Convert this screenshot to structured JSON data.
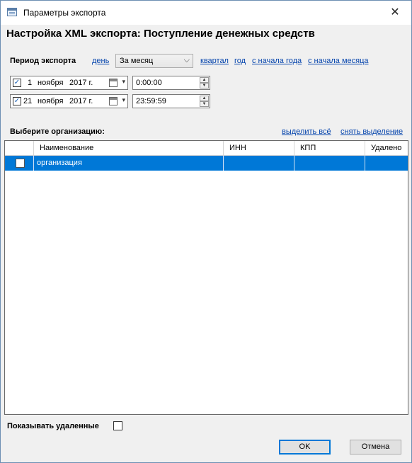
{
  "window": {
    "title": "Параметры экспорта",
    "close_glyph": "✕"
  },
  "header": {
    "title": "Настройка XML экспорта: Поступление денежных средств"
  },
  "period": {
    "label": "Период экспорта",
    "link_day": "день",
    "select_value": "За месяц",
    "link_quarter": "квартал",
    "link_year": "год",
    "link_year_start": "с начала года",
    "link_month_start": "с начала месяца"
  },
  "date_from": {
    "day": "1",
    "month": "ноября",
    "year": "2017 г.",
    "time": "0:00:00",
    "checked": true
  },
  "date_to": {
    "day": "21",
    "month": "ноября",
    "year": "2017 г.",
    "time": "23:59:59",
    "checked": true
  },
  "org": {
    "label": "Выберите организацию:",
    "select_all": "выделить всё",
    "deselect": "снять выделение",
    "columns": [
      "Наименование",
      "ИНН",
      "КПП",
      "Удалено"
    ],
    "rows": [
      {
        "name": "организация",
        "inn": "",
        "kpp": "",
        "deleted": "",
        "checked": false
      }
    ]
  },
  "footer": {
    "show_deleted": "Показывать удаленные",
    "ok": "OK",
    "cancel": "Отмена"
  },
  "icons": {
    "checkmark": "✓",
    "chevron_down": "⌵",
    "dropdown_arrow": "▾",
    "spin_up": "▲",
    "spin_down": "▼"
  },
  "colors": {
    "selection": "#0078d7",
    "link": "#0645ad"
  }
}
